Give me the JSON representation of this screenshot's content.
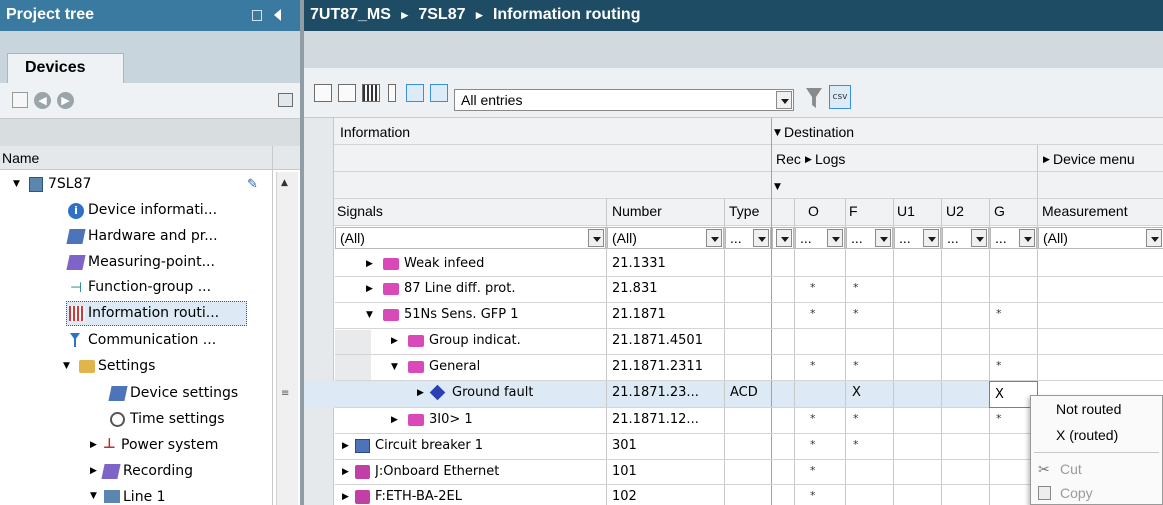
{
  "left_panel": {
    "title": "Project tree",
    "tab_devices": "Devices",
    "column_name": "Name",
    "items": [
      {
        "label": "7SL87"
      },
      {
        "label": "Device informati..."
      },
      {
        "label": "Hardware and pr..."
      },
      {
        "label": "Measuring-point..."
      },
      {
        "label": "Function-group ..."
      },
      {
        "label": "Information routi..."
      },
      {
        "label": "Communication ..."
      },
      {
        "label": "Settings"
      },
      {
        "label": "Device settings"
      },
      {
        "label": "Time settings"
      },
      {
        "label": "Power system"
      },
      {
        "label": "Recording"
      },
      {
        "label": "Line 1"
      }
    ]
  },
  "breadcrumb": {
    "items": [
      "7UT87_MS",
      "7SL87",
      "Information routing"
    ],
    "separator": "▸"
  },
  "toolbar": {
    "filter_value": "All entries",
    "filter_icon": "funnel-icon",
    "export_label": "csv"
  },
  "grid": {
    "header_information": "Information",
    "header_destination": "Destination",
    "header_rec": "Rec",
    "header_logs": "Logs",
    "header_device_menu": "Device menu",
    "columns": {
      "signals": "Signals",
      "number": "Number",
      "type": "Type",
      "o": "O",
      "f": "F",
      "u1": "U1",
      "u2": "U2",
      "g": "G",
      "measurement": "Measurement"
    },
    "filters": {
      "signals": "(All)",
      "number": "(All)",
      "type": "...",
      "o": "...",
      "f": "...",
      "u1": "...",
      "u2": "...",
      "g": "...",
      "measurement": "(All)"
    },
    "rows": [
      {
        "signal": "Weak infeed",
        "number": "21.1331",
        "type": "",
        "o": "",
        "f": "",
        "g": ""
      },
      {
        "signal": "87 Line diff. prot.",
        "number": "21.831",
        "type": "",
        "o": "*",
        "f": "*",
        "g": ""
      },
      {
        "signal": "51Ns Sens. GFP 1",
        "number": "21.1871",
        "type": "",
        "o": "*",
        "f": "*",
        "g": "*"
      },
      {
        "signal": "Group indicat.",
        "number": "21.1871.4501",
        "type": "",
        "o": "",
        "f": "",
        "g": ""
      },
      {
        "signal": "General",
        "number": "21.1871.2311",
        "type": "",
        "o": "*",
        "f": "*",
        "g": "*"
      },
      {
        "signal": "Ground fault",
        "number": "21.1871.23...",
        "type": "ACD",
        "o": "",
        "f": "X",
        "g": "X"
      },
      {
        "signal": "3I0> 1",
        "number": "21.1871.12...",
        "type": "",
        "o": "*",
        "f": "*",
        "g": "*"
      },
      {
        "signal": "Circuit breaker 1",
        "number": "301",
        "type": "",
        "o": "*",
        "f": "*",
        "g": ""
      },
      {
        "signal": "J:Onboard Ethernet",
        "number": "101",
        "type": "",
        "o": "*",
        "f": "",
        "g": ""
      },
      {
        "signal": "F:ETH-BA-2EL",
        "number": "102",
        "type": "",
        "o": "*",
        "f": "",
        "g": ""
      }
    ]
  },
  "context_menu": {
    "items": [
      {
        "label": "Not routed"
      },
      {
        "label": "X (routed)"
      },
      {
        "label": "Cut",
        "icon": "scissors-icon"
      },
      {
        "label": "Copy",
        "icon": "copy-icon"
      }
    ]
  },
  "colors": {
    "header_bg": "#1d4c64",
    "selected_bg": "#ddeaf5",
    "accent": "#3a8fd6"
  }
}
